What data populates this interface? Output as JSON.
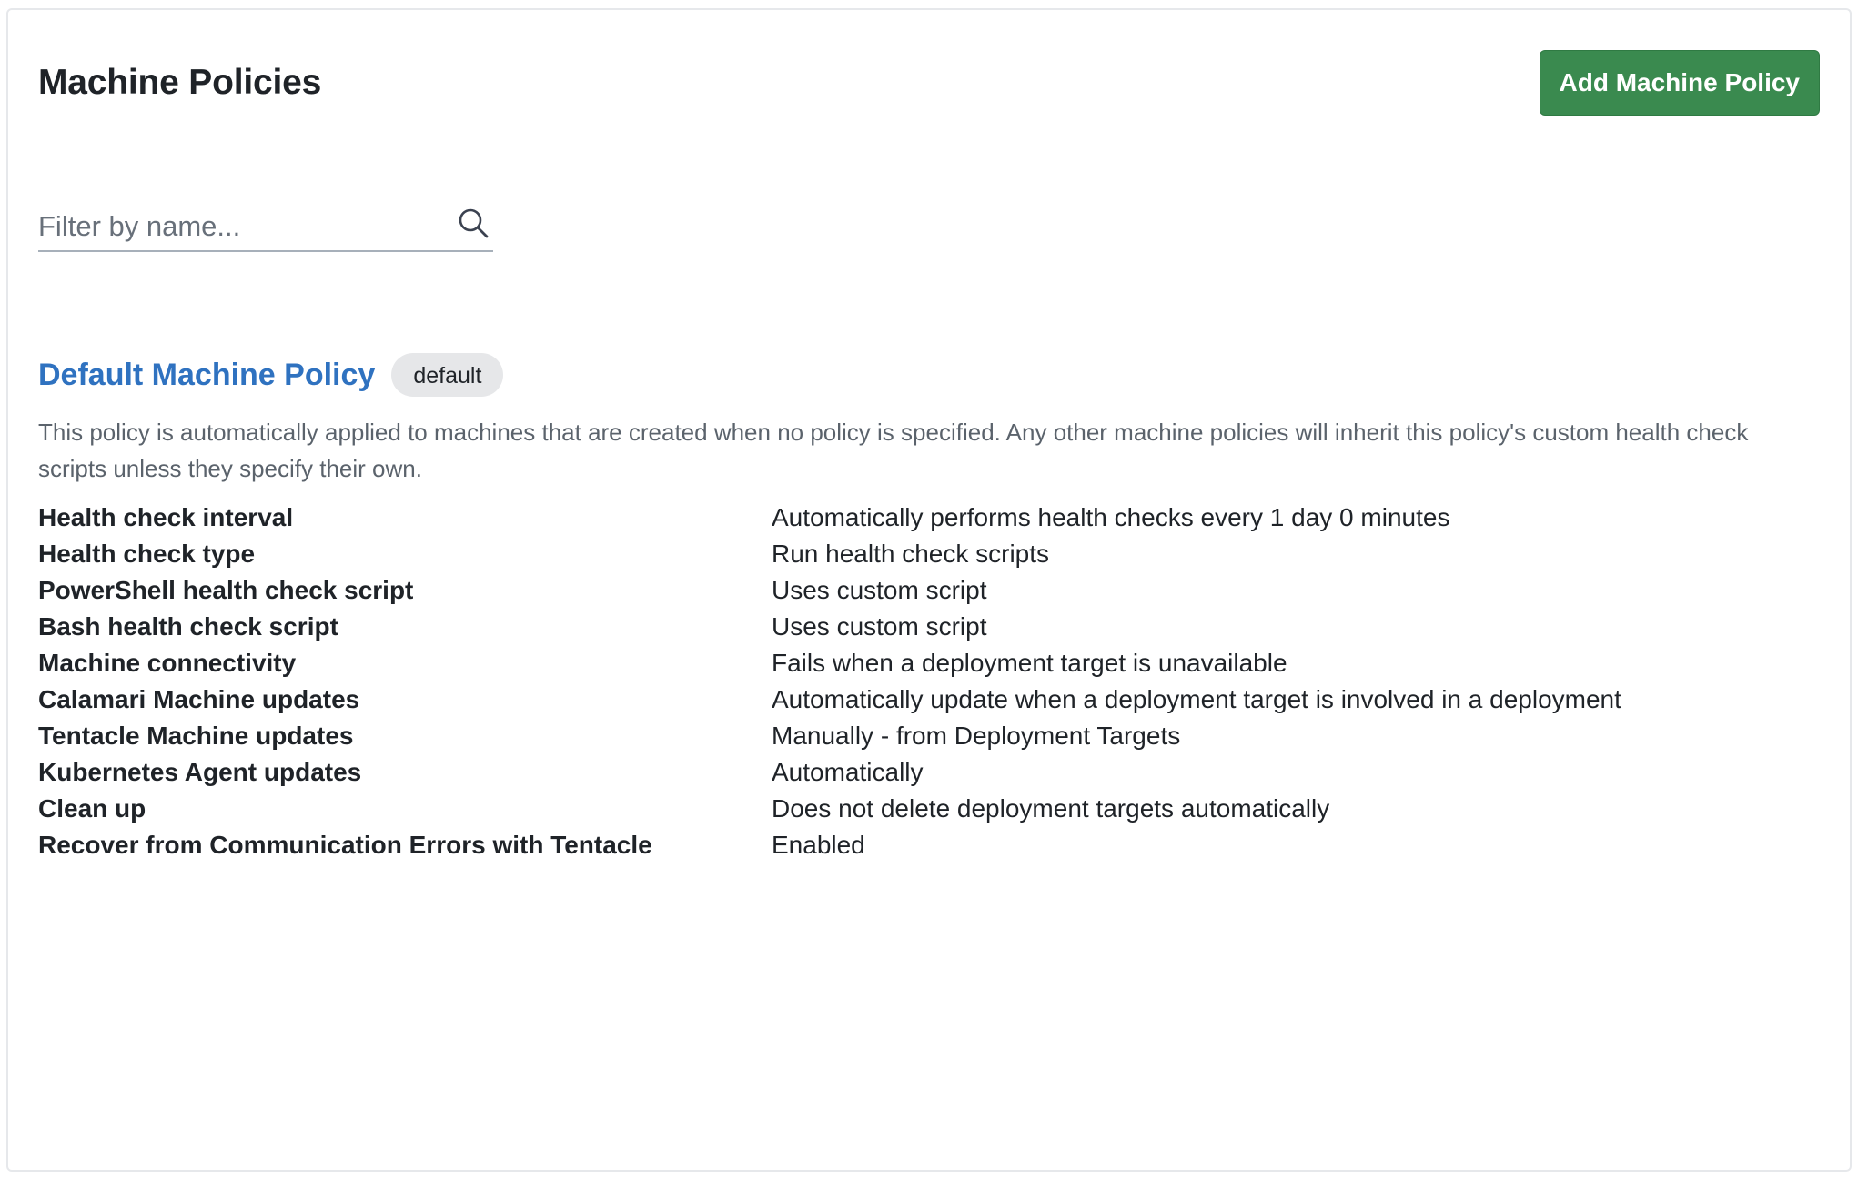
{
  "header": {
    "title": "Machine Policies",
    "add_button_label": "Add Machine Policy"
  },
  "filter": {
    "placeholder": "Filter by name...",
    "value": ""
  },
  "colors": {
    "accent_green": "#3a8a4f",
    "link_blue": "#2f72c0",
    "badge_gray": "#e6e7e9"
  },
  "policy": {
    "name": "Default Machine Policy",
    "badge": "default",
    "description": "This policy is automatically applied to machines that are created when no policy is specified. Any other machine policies will inherit this policy's custom health check scripts unless they specify their own.",
    "details": [
      {
        "label": "Health check interval",
        "value": "Automatically performs health checks every 1 day 0 minutes"
      },
      {
        "label": "Health check type",
        "value": "Run health check scripts"
      },
      {
        "label": "PowerShell health check script",
        "value": "Uses custom script"
      },
      {
        "label": "Bash health check script",
        "value": "Uses custom script"
      },
      {
        "label": "Machine connectivity",
        "value": "Fails when a deployment target is unavailable"
      },
      {
        "label": "Calamari Machine updates",
        "value": "Automatically update when a deployment target is involved in a deployment"
      },
      {
        "label": "Tentacle Machine updates",
        "value": "Manually - from Deployment Targets"
      },
      {
        "label": "Kubernetes Agent updates",
        "value": "Automatically"
      },
      {
        "label": "Clean up",
        "value": "Does not delete deployment targets automatically"
      },
      {
        "label": "Recover from Communication Errors with Tentacle",
        "value": "Enabled"
      }
    ]
  }
}
